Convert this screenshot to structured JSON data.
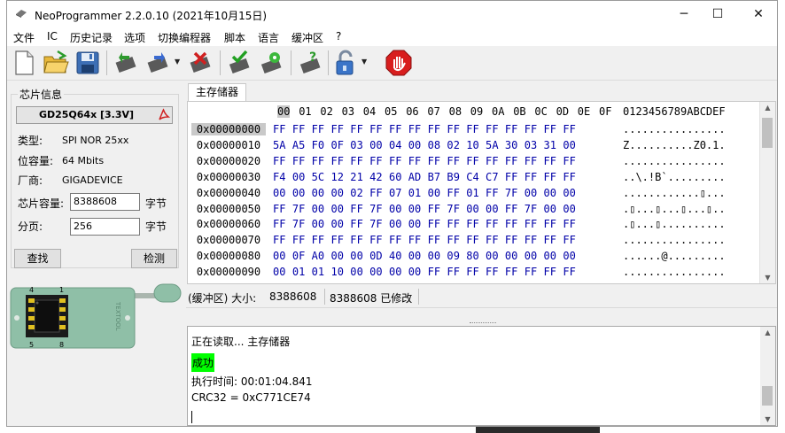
{
  "window": {
    "title": "NeoProgrammer 2.2.0.10 (2021年10月15日)",
    "minimize": "─",
    "maximize": "☐",
    "close": "✕"
  },
  "menu": [
    "文件",
    "IC",
    "历史记录",
    "选项",
    "切换编程器",
    "脚本",
    "语言",
    "缓冲区",
    "?"
  ],
  "toolbar": {
    "icons": [
      "new-file-icon",
      "open-folder-icon",
      "save-icon",
      "read-chip-icon",
      "write-chip-icon",
      "erase-chip-icon",
      "verify-chip-icon",
      "auto-program-icon",
      "blank-check-icon",
      "unlock-icon",
      "stop-icon"
    ]
  },
  "chip_info": {
    "group_title": "芯片信息",
    "chip_name": "GD25Q64x [3.3V]",
    "type_label": "类型:",
    "type_value": "SPI NOR 25xx",
    "size_label": "位容量:",
    "size_value": "64 Mbits",
    "vendor_label": "厂商:",
    "vendor_value": "GIGADEVICE",
    "capacity_label": "芯片容量:",
    "capacity_value": "8388608",
    "capacity_unit": "字节",
    "page_label": "分页:",
    "page_value": "256",
    "page_unit": "字节",
    "search_button": "查找",
    "detect_button": "检测"
  },
  "socket": {
    "brand": "TEXTOOL",
    "pin_labels": [
      "4",
      "1",
      "5",
      "8"
    ]
  },
  "hex_view": {
    "tab_label": "主存储器",
    "columns": [
      "00",
      "01",
      "02",
      "03",
      "04",
      "05",
      "06",
      "07",
      "08",
      "09",
      "0A",
      "0B",
      "0C",
      "0D",
      "0E",
      "0F"
    ],
    "ascii_header": "0123456789ABCDEF",
    "rows": [
      {
        "addr": "0x00000000",
        "hex": "FF FF FF FF FF FF FF FF FF FF FF FF FF FF FF FF",
        "ascii": "................"
      },
      {
        "addr": "0x00000010",
        "hex": "5A A5 F0 0F 03 00 04 00 08 02 10 5A 30 03 31 00",
        "ascii": "Z..........Z0.1."
      },
      {
        "addr": "0x00000020",
        "hex": "FF FF FF FF FF FF FF FF FF FF FF FF FF FF FF FF",
        "ascii": "................"
      },
      {
        "addr": "0x00000030",
        "hex": "F4 00 5C 12 21 42 60 AD B7 B9 C4 C7 FF FF FF FF",
        "ascii": "..\\.!B`........."
      },
      {
        "addr": "0x00000040",
        "hex": "00 00 00 00 02 FF 07 01 00 FF 01 FF 7F 00 00 00",
        "ascii": "............▯..."
      },
      {
        "addr": "0x00000050",
        "hex": "FF 7F 00 00 FF 7F 00 00 FF 7F 00 00 FF 7F 00 00",
        "ascii": ".▯...▯...▯...▯.."
      },
      {
        "addr": "0x00000060",
        "hex": "FF 7F 00 00 FF 7F 00 00 FF FF FF FF FF FF FF FF",
        "ascii": ".▯...▯.........."
      },
      {
        "addr": "0x00000070",
        "hex": "FF FF FF FF FF FF FF FF FF FF FF FF FF FF FF FF",
        "ascii": "................"
      },
      {
        "addr": "0x00000080",
        "hex": "00 0F A0 00 00 0D 40 00 00 09 80 00 00 00 00 00",
        "ascii": "......@........."
      },
      {
        "addr": "0x00000090",
        "hex": "00 01 01 10 00 00 00 00 FF FF FF FF FF FF FF FF",
        "ascii": "................"
      }
    ]
  },
  "status": {
    "buffer_size": "(缓冲区) 大小:",
    "size_value": "8388608",
    "modified": "8388608 已修改"
  },
  "log": {
    "line1": "正在读取... 主存储器",
    "line2": "成功",
    "line3": "执行时间:  00:01:04.841",
    "line4": "CRC32 = 0xC771CE74"
  },
  "colors": {
    "hex_text": "#0000a8",
    "success_bg": "#00ff00",
    "socket_green": "#8fbfa7"
  }
}
